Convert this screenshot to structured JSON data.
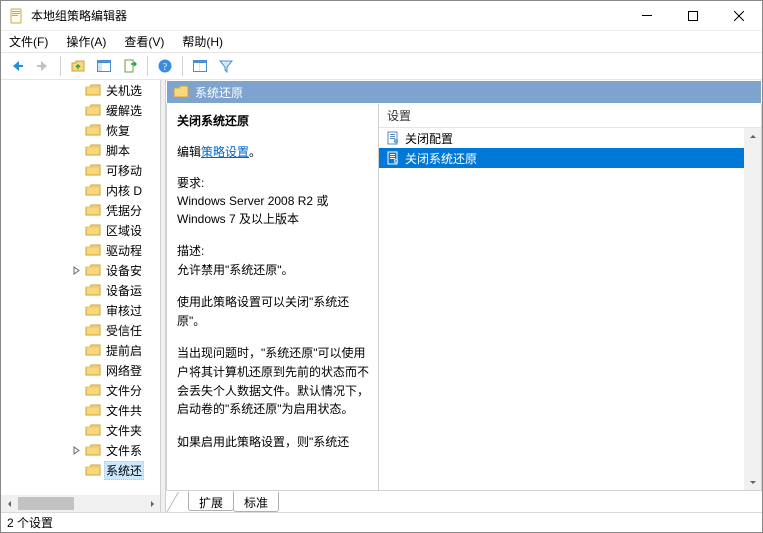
{
  "window": {
    "title": "本地组策略编辑器"
  },
  "menu": {
    "file": "文件(F)",
    "action": "操作(A)",
    "view": "查看(V)",
    "help": "帮助(H)"
  },
  "tree": {
    "items": [
      {
        "depth": 2,
        "twisty": "",
        "label": "关机选"
      },
      {
        "depth": 2,
        "twisty": "",
        "label": "缓解选"
      },
      {
        "depth": 2,
        "twisty": "",
        "label": "恢复"
      },
      {
        "depth": 2,
        "twisty": "",
        "label": "脚本"
      },
      {
        "depth": 2,
        "twisty": "",
        "label": "可移动"
      },
      {
        "depth": 2,
        "twisty": "",
        "label": "内核 D"
      },
      {
        "depth": 2,
        "twisty": "",
        "label": "凭据分"
      },
      {
        "depth": 2,
        "twisty": "",
        "label": "区域设"
      },
      {
        "depth": 2,
        "twisty": "",
        "label": "驱动程"
      },
      {
        "depth": 2,
        "twisty": ">",
        "label": "设备安"
      },
      {
        "depth": 2,
        "twisty": "",
        "label": "设备运"
      },
      {
        "depth": 2,
        "twisty": "",
        "label": "审核过"
      },
      {
        "depth": 2,
        "twisty": "",
        "label": "受信任"
      },
      {
        "depth": 2,
        "twisty": "",
        "label": "提前启"
      },
      {
        "depth": 2,
        "twisty": "",
        "label": "网络登"
      },
      {
        "depth": 2,
        "twisty": "",
        "label": "文件分"
      },
      {
        "depth": 2,
        "twisty": "",
        "label": "文件共"
      },
      {
        "depth": 2,
        "twisty": "",
        "label": "文件夹"
      },
      {
        "depth": 2,
        "twisty": ">",
        "label": "文件系"
      },
      {
        "depth": 2,
        "twisty": "",
        "label": "系统还",
        "selected": true
      }
    ]
  },
  "right": {
    "header": "系统还原",
    "policy_title": "关闭系统还原",
    "edit_prefix": "编辑",
    "edit_link": "策略设置",
    "req_label": "要求:",
    "req_text": "Windows Server 2008 R2 或 Windows 7 及以上版本",
    "desc_label": "描述:",
    "desc_p1": "允许禁用\"系统还原\"。",
    "desc_p2": "使用此策略设置可以关闭\"系统还原\"。",
    "desc_p3": "当出现问题时，\"系统还原\"可以使用户将其计算机还原到先前的状态而不会丢失个人数据文件。默认情况下，启动卷的\"系统还原\"为启用状态。",
    "desc_p4": "如果启用此策略设置，则\"系统还",
    "settings_header": "设置",
    "settings": [
      {
        "label": "关闭配置",
        "selected": false
      },
      {
        "label": "关闭系统还原",
        "selected": true
      }
    ],
    "tabs": {
      "extended": "扩展",
      "standard": "标准"
    }
  },
  "status": {
    "text": "2 个设置"
  }
}
